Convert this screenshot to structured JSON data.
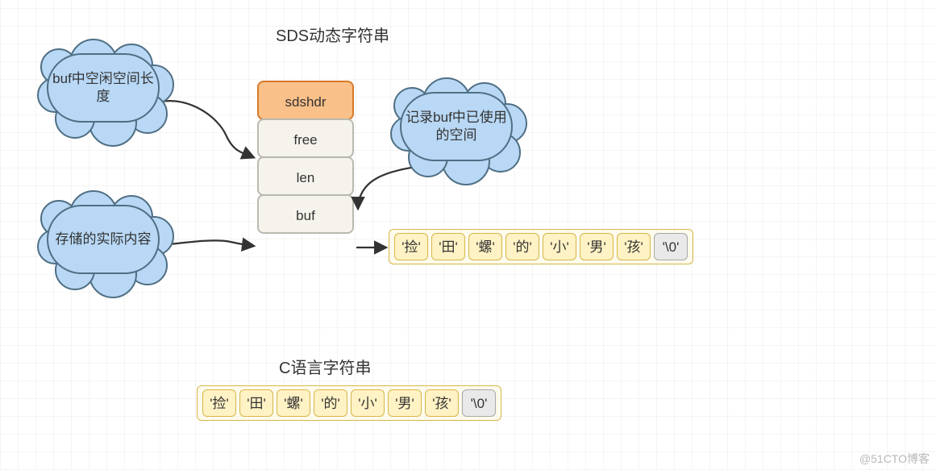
{
  "titles": {
    "sds": "SDS动态字符串",
    "c": "C语言字符串"
  },
  "struct": {
    "head": "sdshdr",
    "free": "free",
    "len": "len",
    "buf": "buf"
  },
  "clouds": {
    "free_desc": "buf中空闲空间长度",
    "len_desc": "记录buf中已使用的空间",
    "buf_desc": "存储的实际内容"
  },
  "sds_chars": [
    "'捡'",
    "'田'",
    "'螺'",
    "'的'",
    "'小'",
    "'男'",
    "'孩'"
  ],
  "sds_term": "'\\0'",
  "c_chars": [
    "'捡'",
    "'田'",
    "'螺'",
    "'的'",
    "'小'",
    "'男'",
    "'孩'"
  ],
  "c_term": "'\\0'",
  "watermark": "@51CTO博客"
}
